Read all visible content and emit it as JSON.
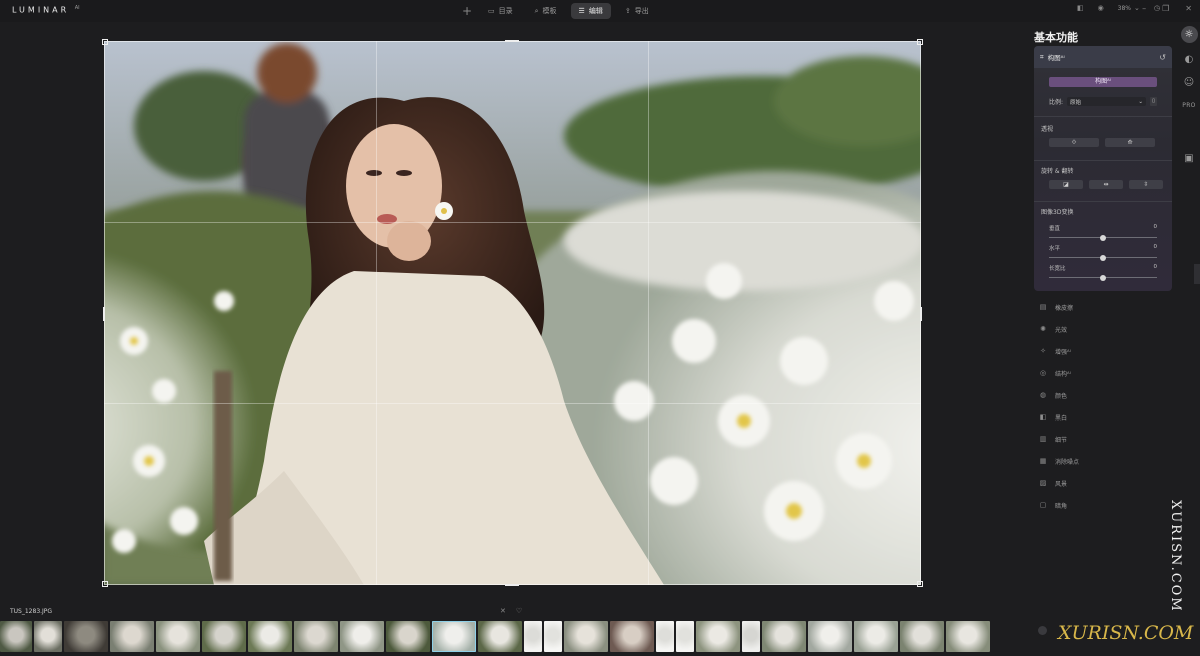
{
  "app": {
    "logo": "LUMINAR",
    "logo_version": "AI"
  },
  "nav": {
    "add_label": "+",
    "tabs": [
      {
        "label": "目录",
        "icon": "folder-icon",
        "active": false
      },
      {
        "label": "模板",
        "icon": "search-icon",
        "active": false
      },
      {
        "label": "编辑",
        "icon": "sliders-icon",
        "active": true
      },
      {
        "label": "导出",
        "icon": "share-icon",
        "active": false
      }
    ]
  },
  "toolbar": {
    "zoom": "38%"
  },
  "panel": {
    "title": "基本功能",
    "crop_card": {
      "header": "构图ᴬᴵ",
      "crop_button": "构图ᴬᴵ",
      "ratio_label": "比例:",
      "ratio_value": "原始",
      "perspective_label": "透视",
      "rotate_label": "旋转 & 翻转",
      "transform_label": "图像3D变换",
      "sliders": [
        {
          "label": "垂直",
          "value": "0",
          "level": 0.5
        },
        {
          "label": "水平",
          "value": "0",
          "level": 0.5
        },
        {
          "label": "长宽比",
          "value": "0",
          "level": 0.5
        }
      ]
    },
    "tools": [
      {
        "label": "橡皮擦",
        "icon": "eraser-icon"
      },
      {
        "label": "光效",
        "icon": "sun-icon"
      },
      {
        "label": "增强ᴬᴵ",
        "icon": "wand-icon"
      },
      {
        "label": "结构ᴬᴵ",
        "icon": "structure-icon"
      },
      {
        "label": "颜色",
        "icon": "color-icon"
      },
      {
        "label": "黑白",
        "icon": "bw-icon"
      },
      {
        "label": "细节",
        "icon": "detail-icon"
      },
      {
        "label": "消除噪点",
        "icon": "denoise-icon"
      },
      {
        "label": "风景",
        "icon": "landscape-icon"
      },
      {
        "label": "暗角",
        "icon": "vignette-icon"
      }
    ],
    "side_pro": "PRO"
  },
  "filmstrip": {
    "filename": "TUS_1283.JPG",
    "selected_index": 10
  },
  "watermark": {
    "vertical": "XURISN.COM",
    "horizontal": "XURISN.COM"
  },
  "colors": {
    "accent": "#6a4f7d",
    "selection": "#8ed0e8"
  }
}
